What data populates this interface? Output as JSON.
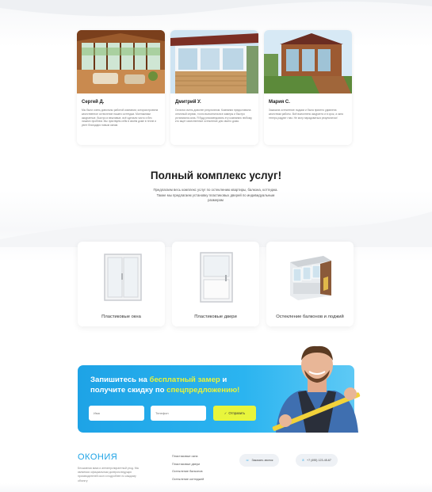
{
  "reviews": [
    {
      "name": "Сергей Д.",
      "text": "Мы были очень довольны работой компании, которая провела качественное остекление нашего коттеджа. Монтажники аккуратные, быстро и вежливые, всё сделали чисто и без лишних проблем. Мы чувствуем себя в своём доме в тепле и уюте благодаря новым окнам."
    },
    {
      "name": "Дмитрий У.",
      "text": "Остался очень доволен результатом. Компания предоставила отличный сервис, точно выполнила все замеры и быстро установила окна. Я буду рекомендовать эту компанию любому, кто ищет качественное остекление для своего дома."
    },
    {
      "name": "Мария С.",
      "text": "Заказала остекление лоджии и была приятно удивлена качеством работы. Всё выполнено аккуратно и в срок, а окна теперь радуют глаз. Не могу нарадоваться результатом!"
    }
  ],
  "services": {
    "title": "Полный комплекс услуг!",
    "subtitle": "Предлагаем весь комплекс услуг по остеклению квартиры, балкона, коттеджа. Также мы предлагаем установку пластиковых дверей по индивидуальным размерам",
    "cards": [
      {
        "label": "Пластиковые окна"
      },
      {
        "label": "Пластиковые двери"
      },
      {
        "label": "Остекление балконов и лоджий"
      }
    ]
  },
  "banner": {
    "line1_start": "Запишитесь на ",
    "line1_highlight": "бесплатный замер",
    "line1_end": " и",
    "line2_start": "получите скидку по ",
    "line2_highlight": "спецпредложению!",
    "name_placeholder": "Имя",
    "phone_placeholder": "Телефон",
    "submit_label": "Отправить"
  },
  "footer": {
    "logo": "ОКОНИЯ",
    "description": "Бесшовная мика и антиперспирантный уход. Мы являемся официальным дилером ведущих производителей окон и подробнее по каждому объекту",
    "links": [
      "Пластиковые окна",
      "Пластиковые двери",
      "Остекление балконов",
      "Остекление коттеджей"
    ],
    "callback_label": "Заказать звонок",
    "phone": "+7 (495) 123-45-67"
  },
  "colors": {
    "accent": "#1ea3e6",
    "highlight": "#e7f33a",
    "button": "#e8f53c"
  }
}
